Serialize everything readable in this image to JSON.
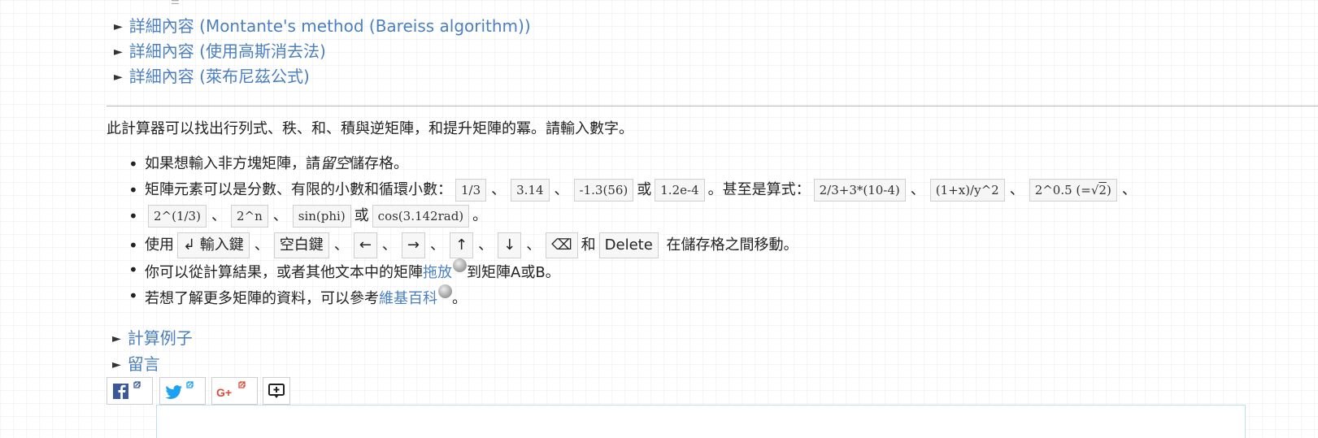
{
  "details": [
    {
      "label": "詳細內容 (Montante's method (Bareiss algorithm))"
    },
    {
      "label": "詳細內容 (使用高斯消去法)"
    },
    {
      "label": "詳細內容 (萊布尼茲公式)"
    }
  ],
  "intro": "此計算器可以找出行列式、秩、和、積與逆矩陣，和提升矩陣的冪。請輸入數字。",
  "rule1": {
    "pre": "如果想輸入非方塊矩陣，請",
    "em": "留空",
    "post": "儲存格。"
  },
  "rule2": {
    "lead": "矩陣元素可以是分數、有限的小數和循環小數：",
    "nums": [
      "1/3",
      "3.14",
      "-1.3(56)",
      "1.2e-4"
    ],
    "or1": "或",
    "mid": "。甚至是算式：",
    "exprs": [
      "2/3+3*(10-4)",
      "(1+x)/y^2",
      "2^0.5 (=",
      "2",
      ")"
    ],
    "exprs2": [
      "2^(1/3)",
      "2^n",
      "sin(phi)",
      "cos(3.142rad)"
    ],
    "or2": "或",
    "end": "。"
  },
  "rule3": {
    "lead": "使用",
    "keys": [
      "↲ 輸入鍵",
      "空白鍵",
      "←",
      "→",
      "↑",
      "↓",
      "⌫"
    ],
    "and": "和",
    "delete": "Delete",
    "end": "在儲存格之間移動。"
  },
  "rule4": {
    "pre": "你可以從計算結果，或者其他文本中的矩陣",
    "link": "拖放",
    "post": "到矩陣A或B。"
  },
  "rule5": {
    "pre": "若想了解更多矩陣的資料，可以參考",
    "link": "維基百科",
    "post": "。"
  },
  "toggles": {
    "examples": "計算例子",
    "comments": "留言"
  },
  "sep": "、",
  "colors": {
    "link": "#4a7fc1",
    "facebook": "#3b5998",
    "twitter": "#1da1f2",
    "gplus": "#dd4b39"
  }
}
